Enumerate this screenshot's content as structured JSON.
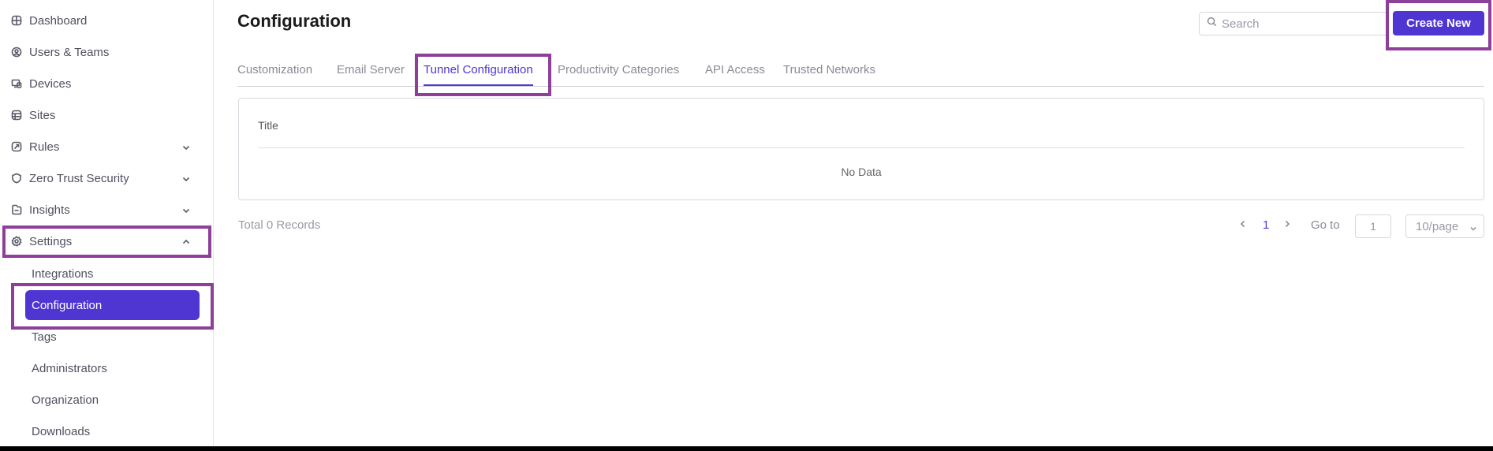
{
  "sidebar": {
    "items": [
      {
        "label": "Dashboard",
        "icon": "dashboard-icon"
      },
      {
        "label": "Users & Teams",
        "icon": "user-icon"
      },
      {
        "label": "Devices",
        "icon": "devices-icon"
      },
      {
        "label": "Sites",
        "icon": "sites-icon"
      },
      {
        "label": "Rules",
        "icon": "rules-icon",
        "expandable": true
      },
      {
        "label": "Zero Trust Security",
        "icon": "shield-icon",
        "expandable": true
      },
      {
        "label": "Insights",
        "icon": "insights-icon",
        "expandable": true
      },
      {
        "label": "Settings",
        "icon": "gear-icon",
        "expanded": true
      }
    ],
    "settings_sub": [
      {
        "label": "Integrations"
      },
      {
        "label": "Configuration",
        "active": true
      },
      {
        "label": "Tags"
      },
      {
        "label": "Administrators"
      },
      {
        "label": "Organization"
      },
      {
        "label": "Downloads"
      }
    ]
  },
  "header": {
    "title": "Configuration",
    "search_placeholder": "Search",
    "create_label": "Create New"
  },
  "tabs": [
    {
      "label": "Customization"
    },
    {
      "label": "Email Server"
    },
    {
      "label": "Tunnel Configuration",
      "active": true
    },
    {
      "label": "Productivity Categories"
    },
    {
      "label": "API Access"
    },
    {
      "label": "Trusted Networks"
    }
  ],
  "table": {
    "columns": [
      "Title"
    ],
    "empty_text": "No Data"
  },
  "footer": {
    "total_text": "Total 0  Records",
    "current_page": "1",
    "goto_label": "Go to",
    "goto_value": "1",
    "page_size": "10/page"
  },
  "colors": {
    "accent": "#4f35d2",
    "highlight": "#8d3f99"
  }
}
